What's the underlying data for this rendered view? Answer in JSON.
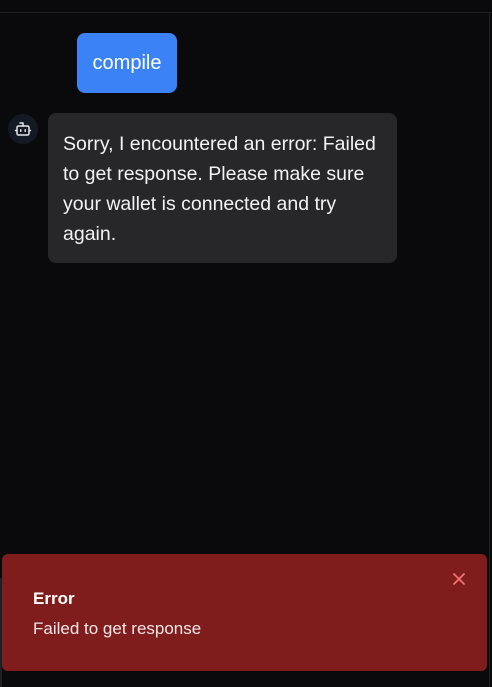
{
  "conversation": {
    "user_message": "compile",
    "bot_message": "Sorry, I encountered an error: Failed to get response. Please make sure your wallet is connected and try again.",
    "bot_avatar_icon": "robot-icon"
  },
  "toast": {
    "title": "Error",
    "message": "Failed to get response",
    "close_icon": "close-icon"
  },
  "colors": {
    "background": "#0a0a0c",
    "user_bubble": "#3b82f6",
    "bot_bubble": "#272729",
    "toast_background": "#7f1d1d",
    "toast_close": "#f87171"
  }
}
